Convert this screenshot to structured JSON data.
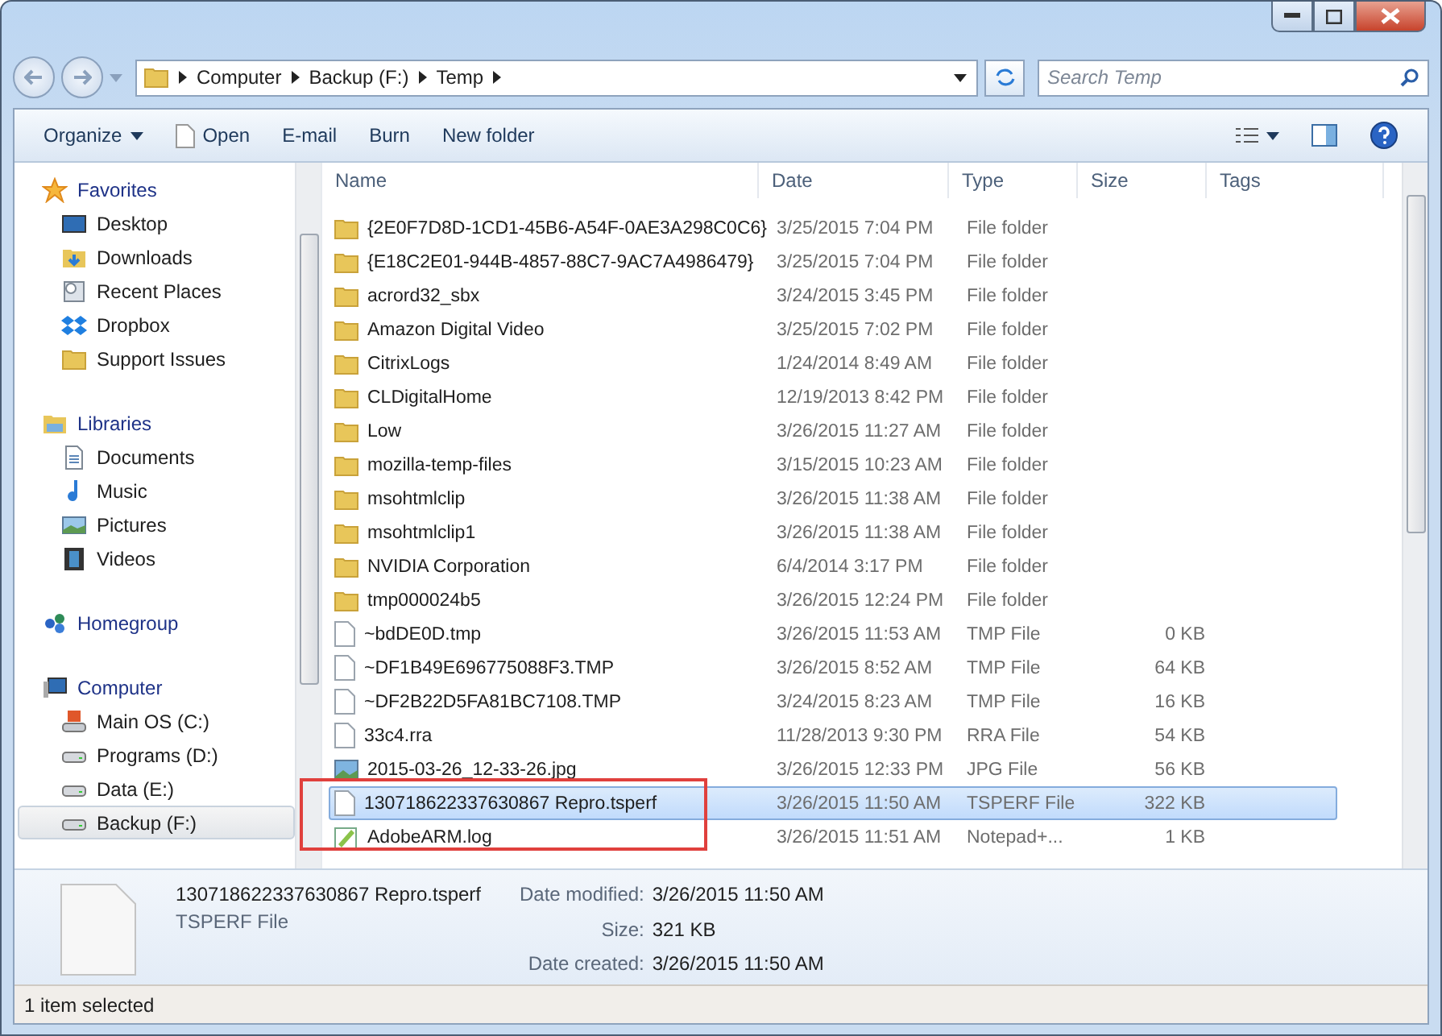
{
  "address": {
    "crumbs": [
      "Computer",
      "Backup (F:)",
      "Temp"
    ]
  },
  "search": {
    "placeholder": "Search Temp"
  },
  "toolbar": {
    "buttons": [
      {
        "label": "Organize",
        "kind": "menu"
      },
      {
        "label": "Open",
        "kind": "file"
      },
      {
        "label": "E-mail",
        "kind": "plain"
      },
      {
        "label": "Burn",
        "kind": "plain"
      },
      {
        "label": "New folder",
        "kind": "plain"
      }
    ]
  },
  "sidebar": {
    "sections": [
      {
        "label": "Favorites",
        "kind": "star",
        "selected": false,
        "children": [
          {
            "label": "Desktop",
            "kind": "desktop",
            "selected": false
          },
          {
            "label": "Downloads",
            "kind": "download",
            "selected": false
          },
          {
            "label": "Recent Places",
            "kind": "recent",
            "selected": false
          },
          {
            "label": "Dropbox",
            "kind": "dropbox",
            "selected": false
          },
          {
            "label": "Support Issues",
            "kind": "folder",
            "selected": false
          }
        ]
      },
      {
        "label": "Libraries",
        "kind": "library",
        "selected": false,
        "children": [
          {
            "label": "Documents",
            "kind": "document",
            "selected": false
          },
          {
            "label": "Music",
            "kind": "music",
            "selected": false
          },
          {
            "label": "Pictures",
            "kind": "picture",
            "selected": false
          },
          {
            "label": "Videos",
            "kind": "video",
            "selected": false
          }
        ]
      },
      {
        "label": "Homegroup",
        "kind": "homegroup",
        "selected": false
      },
      {
        "label": "Computer",
        "kind": "computer",
        "selected": false,
        "children": [
          {
            "label": "Main OS (C:)",
            "kind": "osdrive",
            "selected": false
          },
          {
            "label": "Programs (D:)",
            "kind": "drive",
            "selected": false
          },
          {
            "label": "Data (E:)",
            "kind": "drive",
            "selected": false
          },
          {
            "label": "Backup (F:)",
            "kind": "drive",
            "selected": true
          }
        ]
      }
    ]
  },
  "table": {
    "columns": [
      "Name",
      "Date",
      "Type",
      "Size",
      "Tags"
    ],
    "rows": [
      {
        "name": "{2E0F7D8D-1CD1-45B6-A54F-0AE3A298C0C6}",
        "date": "3/25/2015 7:04 PM",
        "type": "File folder",
        "size": "",
        "kind": "folder",
        "selected": false
      },
      {
        "name": "{E18C2E01-944B-4857-88C7-9AC7A4986479}",
        "date": "3/25/2015 7:04 PM",
        "type": "File folder",
        "size": "",
        "kind": "folder",
        "selected": false
      },
      {
        "name": "acrord32_sbx",
        "date": "3/24/2015 3:45 PM",
        "type": "File folder",
        "size": "",
        "kind": "folder",
        "selected": false
      },
      {
        "name": "Amazon Digital Video",
        "date": "3/25/2015 7:02 PM",
        "type": "File folder",
        "size": "",
        "kind": "folder",
        "selected": false
      },
      {
        "name": "CitrixLogs",
        "date": "1/24/2014 8:49 AM",
        "type": "File folder",
        "size": "",
        "kind": "folder",
        "selected": false
      },
      {
        "name": "CLDigitalHome",
        "date": "12/19/2013 8:42 PM",
        "type": "File folder",
        "size": "",
        "kind": "folder",
        "selected": false
      },
      {
        "name": "Low",
        "date": "3/26/2015 11:27 AM",
        "type": "File folder",
        "size": "",
        "kind": "folder",
        "selected": false
      },
      {
        "name": "mozilla-temp-files",
        "date": "3/15/2015 10:23 AM",
        "type": "File folder",
        "size": "",
        "kind": "folder",
        "selected": false
      },
      {
        "name": "msohtmlclip",
        "date": "3/26/2015 11:38 AM",
        "type": "File folder",
        "size": "",
        "kind": "folder",
        "selected": false
      },
      {
        "name": "msohtmlclip1",
        "date": "3/26/2015 11:38 AM",
        "type": "File folder",
        "size": "",
        "kind": "folder",
        "selected": false
      },
      {
        "name": "NVIDIA Corporation",
        "date": "6/4/2014 3:17 PM",
        "type": "File folder",
        "size": "",
        "kind": "folder",
        "selected": false
      },
      {
        "name": "tmp000024b5",
        "date": "3/26/2015 12:24 PM",
        "type": "File folder",
        "size": "",
        "kind": "folder",
        "selected": false
      },
      {
        "name": "~bdDE0D.tmp",
        "date": "3/26/2015 11:53 AM",
        "type": "TMP File",
        "size": "0 KB",
        "kind": "file",
        "selected": false
      },
      {
        "name": "~DF1B49E696775088F3.TMP",
        "date": "3/26/2015 8:52 AM",
        "type": "TMP File",
        "size": "64 KB",
        "kind": "file",
        "selected": false
      },
      {
        "name": "~DF2B22D5FA81BC7108.TMP",
        "date": "3/24/2015 8:23 AM",
        "type": "TMP File",
        "size": "16 KB",
        "kind": "file",
        "selected": false
      },
      {
        "name": "33c4.rra",
        "date": "11/28/2013 9:30 PM",
        "type": "RRA File",
        "size": "54 KB",
        "kind": "file",
        "selected": false
      },
      {
        "name": "2015-03-26_12-33-26.jpg",
        "date": "3/26/2015 12:33 PM",
        "type": "JPG File",
        "size": "56 KB",
        "kind": "image",
        "selected": false
      },
      {
        "name": "130718622337630867 Repro.tsperf",
        "date": "3/26/2015 11:50 AM",
        "type": "TSPERF File",
        "size": "322 KB",
        "kind": "file",
        "selected": true
      },
      {
        "name": "AdobeARM.log",
        "date": "3/26/2015 11:51 AM",
        "type": "Notepad+...",
        "size": "1 KB",
        "kind": "log",
        "selected": false
      }
    ]
  },
  "details": {
    "name": "130718622337630867 Repro.tsperf",
    "type": "TSPERF File",
    "fields": [
      {
        "label": "Date modified:",
        "value": "3/26/2015 11:50 AM"
      },
      {
        "label": "Size:",
        "value": "321 KB"
      },
      {
        "label": "Date created:",
        "value": "3/26/2015 11:50 AM"
      }
    ]
  },
  "status_bar": {
    "text": "1 item selected"
  }
}
